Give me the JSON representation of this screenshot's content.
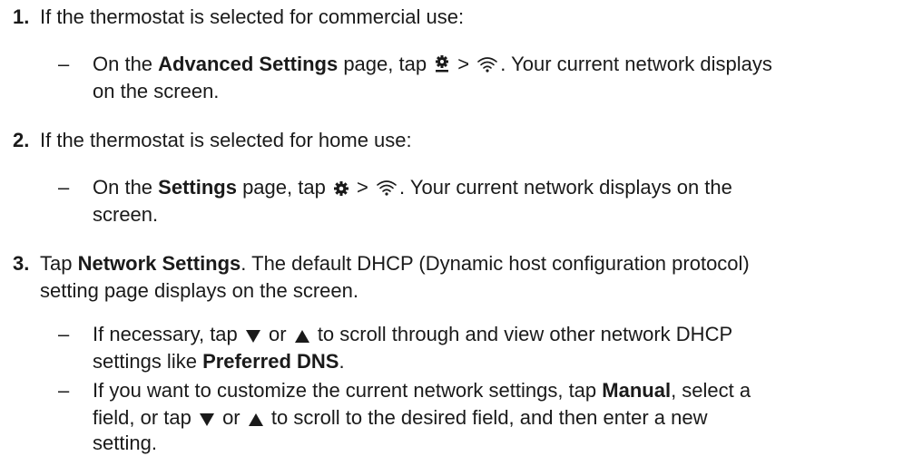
{
  "steps": [
    {
      "number": "1.",
      "text": "If the thermostat is selected for commercial use:",
      "bullets": [
        {
          "pre": "On the ",
          "bold": "Advanced Settings",
          "mid": " page, tap ",
          "sep": " > ",
          "post": ". Your current network displays",
          "cont": "on the screen."
        }
      ]
    },
    {
      "number": "2.",
      "text": "If the thermostat is selected for home use:",
      "bullets": [
        {
          "pre": "On the ",
          "bold": "Settings",
          "mid": " page, tap ",
          "sep": " > ",
          "post": ". Your current network displays on the",
          "cont": "screen."
        }
      ]
    },
    {
      "number": "3.",
      "pre": "Tap ",
      "bold": "Network Settings",
      "post": ". The default DHCP (Dynamic host configuration protocol)",
      "cont": "setting page displays on the screen.",
      "bullets": [
        {
          "l1_pre": "If necessary, tap ",
          "l1_or": " or ",
          "l1_post": " to scroll through and view other network DHCP",
          "l2_pre": "settings like ",
          "l2_bold": "Preferred DNS",
          "l2_post": "."
        },
        {
          "l1_pre": "If you want to customize the current network settings, tap ",
          "l1_bold": "Manual",
          "l1_post": ", select a",
          "l2_pre": "field, or tap ",
          "l2_or": " or ",
          "l2_post": " to scroll to the desired field, and then enter a new",
          "l3": "setting."
        }
      ]
    }
  ],
  "icons": {
    "advanced_gear": "gear-with-underline-icon",
    "gear": "gear-icon",
    "wifi": "wifi-icon",
    "down": "triangle-down-icon",
    "up": "triangle-up-icon"
  },
  "dash": "–"
}
